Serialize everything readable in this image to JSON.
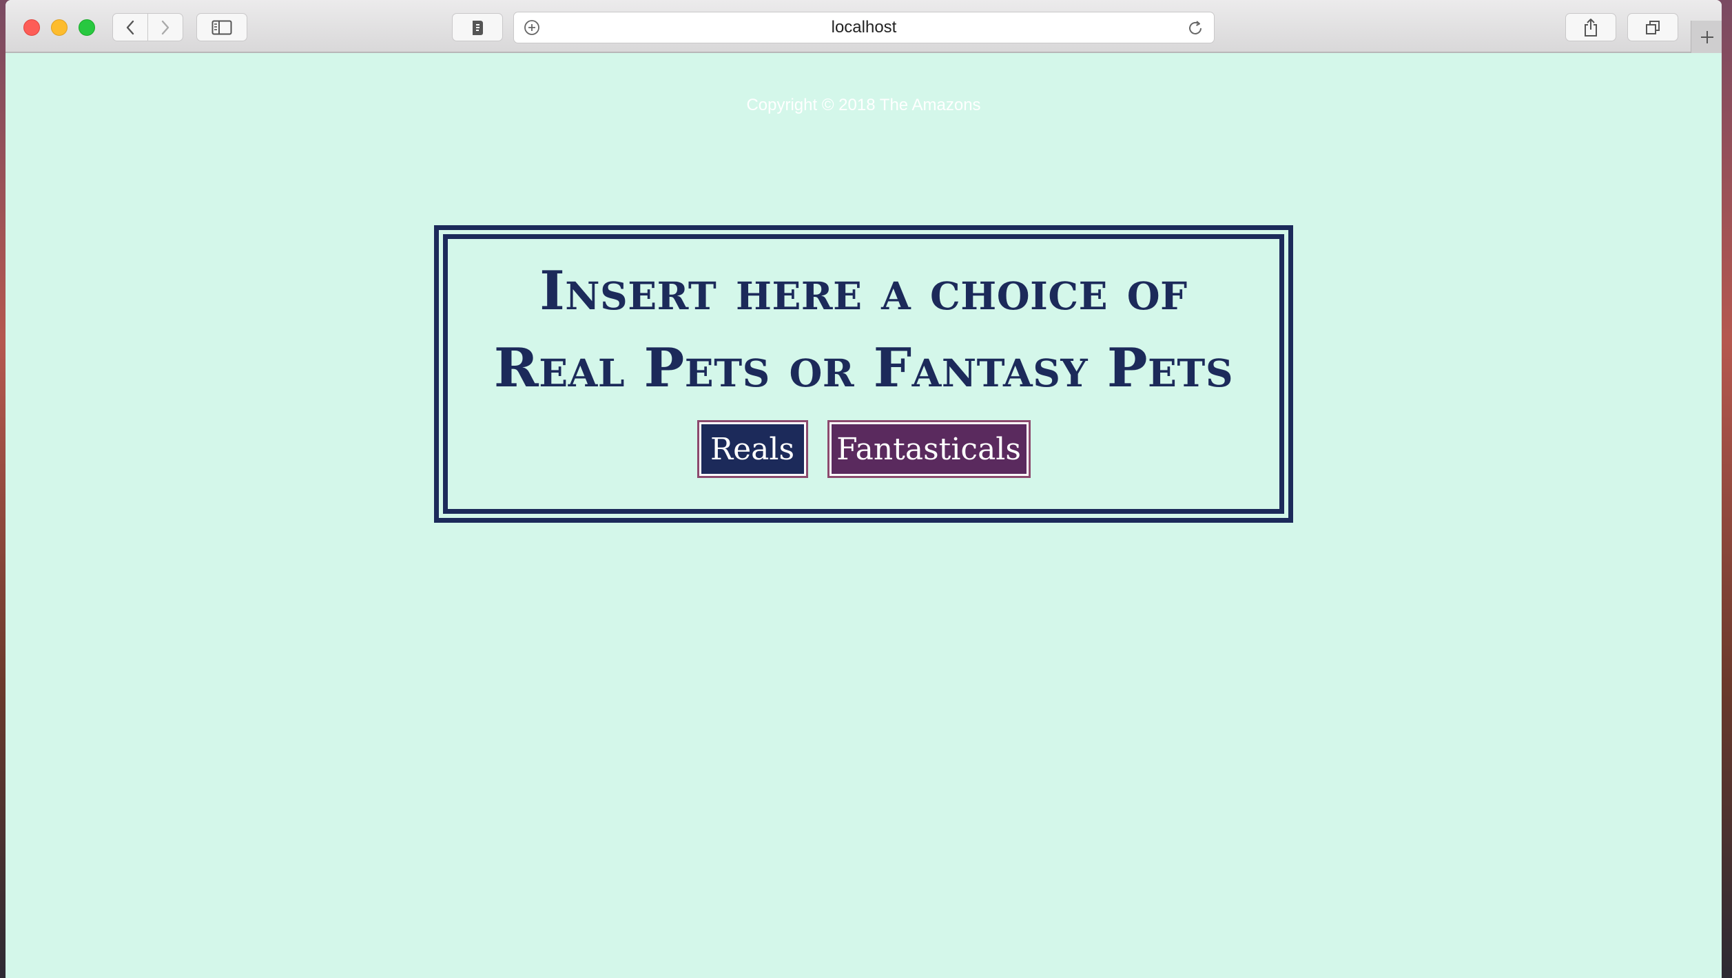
{
  "browser": {
    "url": "localhost"
  },
  "page": {
    "copyright": "Copyright © 2018 The Amazons",
    "headline_line1": "Insert here a choice of",
    "headline_line2": "Real Pets or Fantasy Pets",
    "buttons": {
      "reals": "Reals",
      "fantasticals": "Fantasticals"
    }
  },
  "colors": {
    "page_background": "#d4f7ea",
    "navy": "#1c2a5a",
    "plum": "#5a2a5e",
    "button_border": "#8c4a6e"
  },
  "icons": {
    "back": "chevron-left-icon",
    "forward": "chevron-right-icon",
    "sidebar": "sidebar-icon",
    "extension": "extension-icon",
    "add": "plus-circle-icon",
    "reload": "reload-icon",
    "share": "share-icon",
    "tabs": "tabs-overview-icon",
    "new_tab": "plus-icon"
  }
}
